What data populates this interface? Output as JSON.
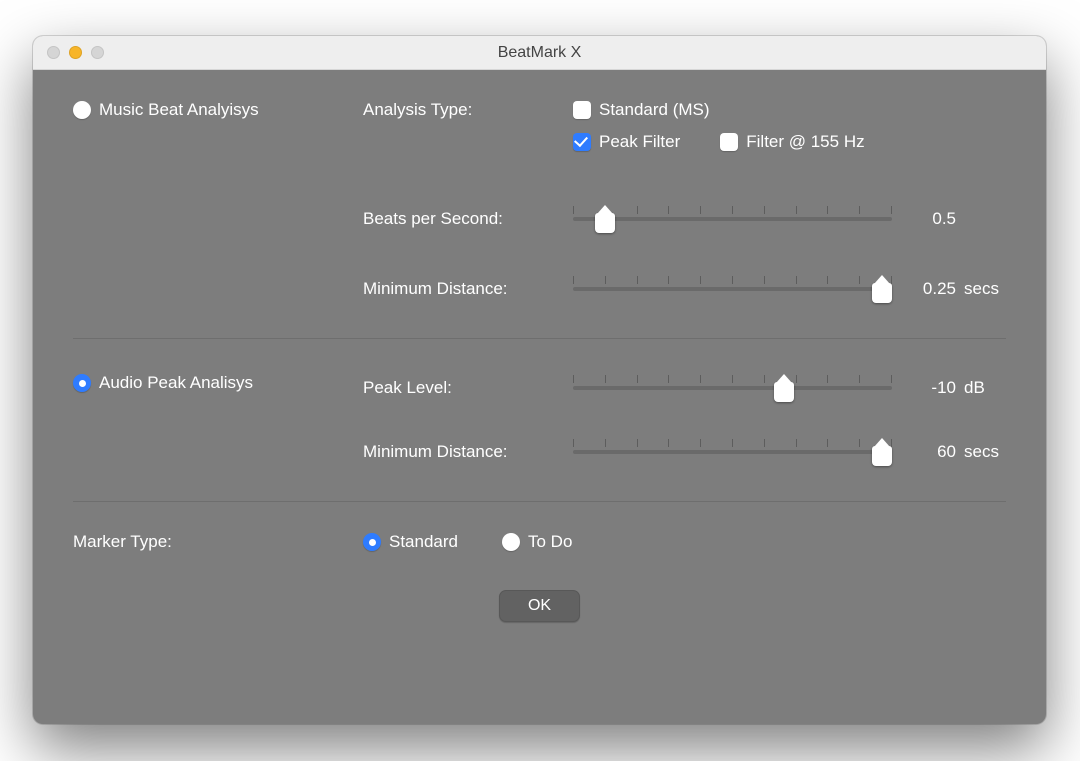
{
  "window": {
    "title": "BeatMark X"
  },
  "section_music": {
    "radio_label": "Music Beat Analyisys",
    "selected": false,
    "analysis_type_label": "Analysis Type:",
    "chk_standard": {
      "label": "Standard (MS)",
      "checked": false
    },
    "chk_peakfilter": {
      "label": "Peak Filter",
      "checked": true
    },
    "chk_filter155": {
      "label": "Filter @ 155 Hz",
      "checked": false
    },
    "bps": {
      "label": "Beats per Second:",
      "value": "0.5",
      "unit": "",
      "pos_pct": 10,
      "ticks": 11
    },
    "mindist": {
      "label": "Minimum Distance:",
      "value": "0.25",
      "unit": "secs",
      "pos_pct": 97,
      "ticks": 11
    }
  },
  "section_audio": {
    "radio_label": "Audio Peak Analisys",
    "selected": true,
    "peak": {
      "label": "Peak Level:",
      "value": "-10",
      "unit": "dB",
      "pos_pct": 66,
      "ticks": 11
    },
    "mindist": {
      "label": "Minimum Distance:",
      "value": "60",
      "unit": "secs",
      "pos_pct": 97,
      "ticks": 11
    }
  },
  "marker": {
    "label": "Marker Type:",
    "opt_standard": {
      "label": "Standard",
      "selected": true
    },
    "opt_todo": {
      "label": "To Do",
      "selected": false
    }
  },
  "buttons": {
    "ok": "OK"
  }
}
